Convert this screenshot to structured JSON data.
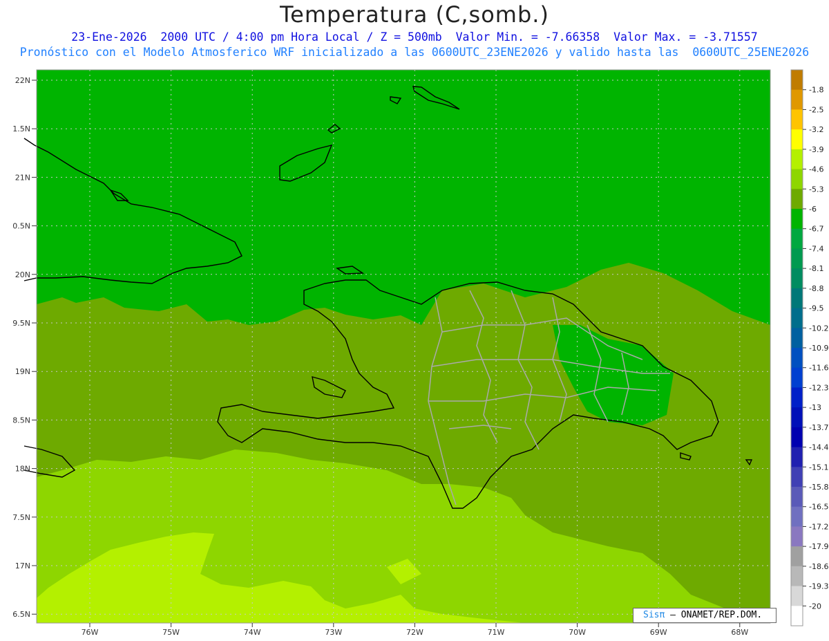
{
  "header": {
    "title": "Temperatura (C,somb.)",
    "subtitle_line1": "23-Ene-2026  2000 UTC / 4:00 pm Hora Local / Z = 500mb  Valor Min. = -7.66358  Valor Max. = -3.71557",
    "subtitle_line2": "Pronóstico con el Modelo Atmosferico WRF inicializado a las 0600UTC_23ENE2026 y valido hasta las  0600UTC_25ENE2026"
  },
  "map": {
    "lat_labels": [
      "22N",
      "1.5N",
      "21N",
      "0.5N",
      "20N",
      "9.5N",
      "19N",
      "8.5N",
      "18N",
      "7.5N",
      "17N",
      "6.5N"
    ],
    "lon_labels": [
      "76W",
      "75W",
      "74W",
      "73W",
      "72W",
      "71W",
      "70W",
      "69W",
      "68W"
    ],
    "colors": {
      "band_-6_-5.3": "#6eaa00",
      "band_-5.3_-4.6": "#8ed600",
      "band_-4.6_-3.9": "#b4f000",
      "band_-6.7_-6": "#00b400",
      "band_-7.4_-6.7": "#00a840",
      "coastline": "#000000",
      "provinces": "#aaaaaa",
      "grid": "#c8c8c8"
    }
  },
  "colorbar": {
    "labels": [
      "-1.8",
      "-2.5",
      "-3.2",
      "-3.9",
      "-4.6",
      "-5.3",
      "-6",
      "-6.7",
      "-7.4",
      "-8.1",
      "-8.8",
      "-9.5",
      "-10.2",
      "-10.9",
      "-11.6",
      "-12.3",
      "-13",
      "-13.7",
      "-14.4",
      "-15.1",
      "-15.8",
      "-16.5",
      "-17.2",
      "-17.9",
      "-18.6",
      "-19.3",
      "-20"
    ],
    "colors": [
      "#c07c00",
      "#e09800",
      "#ffc400",
      "#ffff00",
      "#b4f000",
      "#8ed600",
      "#6eaa00",
      "#00b400",
      "#00a840",
      "#009a50",
      "#008c60",
      "#007878",
      "#006e8c",
      "#0060a0",
      "#0050c0",
      "#0040d0",
      "#0020c8",
      "#0010b8",
      "#0000b0",
      "#2020b0",
      "#4040b4",
      "#5a5ab8",
      "#7070c0",
      "#8a78c0",
      "#a0a0a0",
      "#b8b8b8",
      "#d8d8d8",
      "#ffffff"
    ]
  },
  "credit": {
    "logo_text": "Sis",
    "logo_mark": "π",
    "text": "– ONAMET/REP.DOM."
  }
}
